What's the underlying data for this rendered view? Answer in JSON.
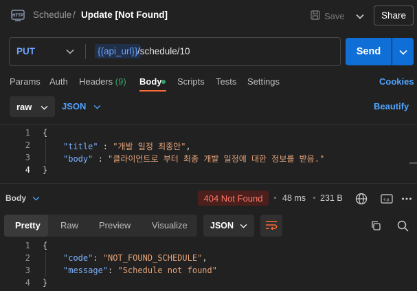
{
  "header": {
    "parent": "Schedule",
    "separator": "/",
    "title": "Update [Not Found]",
    "save_label": "Save",
    "share_label": "Share"
  },
  "request": {
    "method": "PUT",
    "url_variable": "{{api_url}}",
    "url_path": "/schedule/10",
    "send_label": "Send"
  },
  "tabs": [
    {
      "label": "Params"
    },
    {
      "label": "Auth"
    },
    {
      "label": "Headers",
      "count": "(9)"
    },
    {
      "label": "Body"
    },
    {
      "label": "Scripts"
    },
    {
      "label": "Tests"
    },
    {
      "label": "Settings"
    }
  ],
  "cookies_label": "Cookies",
  "body_options": {
    "mode": "raw",
    "format": "JSON",
    "beautify_label": "Beautify"
  },
  "request_body": {
    "line_numbers": [
      "1",
      "2",
      "3",
      "4"
    ],
    "open": "{",
    "title_key": "\"title\"",
    "title_value": "\"개발 일정 최종안\"",
    "body_key": "\"body\"",
    "body_value": "\"클라이언트로 부터 최종 개발 일정에 대한 정보를 받음.\"",
    "close": "}"
  },
  "response": {
    "label": "Body",
    "status": "404 Not Found",
    "time": "48 ms",
    "size": "231 B",
    "views": [
      "Pretty",
      "Raw",
      "Preview",
      "Visualize"
    ],
    "format": "JSON",
    "line_numbers": [
      "1",
      "2",
      "3",
      "4"
    ],
    "open": "{",
    "code_key": "\"code\"",
    "code_value": "\"NOT_FOUND_SCHEDULE\"",
    "message_key": "\"message\"",
    "message_value": "\"Schedule not found\"",
    "close": "}"
  },
  "colors": {
    "accent": "#ff6c37",
    "link": "#4fa3ff",
    "send": "#0f6fd6",
    "error": "#ff7a6a",
    "success": "#38a169"
  },
  "icons": [
    "http-icon",
    "save-icon",
    "chevron-down-icon",
    "globe-icon",
    "example-icon",
    "more-icon",
    "wrap-lines-icon",
    "copy-icon",
    "search-icon"
  ]
}
